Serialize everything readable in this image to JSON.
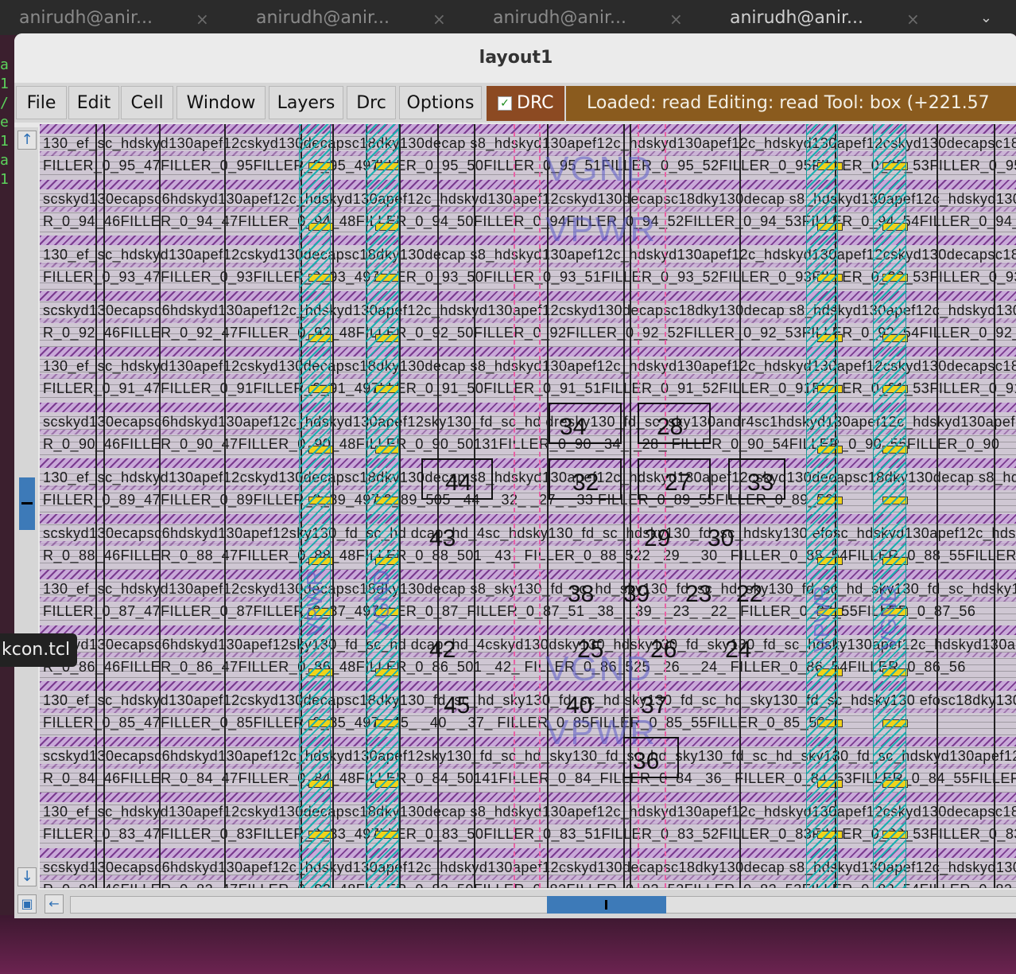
{
  "terminal_tabs": [
    {
      "label": "anirudh@anir...",
      "close": "×"
    },
    {
      "label": "anirudh@anir...",
      "close": "×"
    },
    {
      "label": "anirudh@anir...",
      "close": "×"
    },
    {
      "label": "anirudh@anir...",
      "close": "×"
    }
  ],
  "tab_menu_icon": "chevron-down-icon",
  "tooltip": "kcon.tcl",
  "window": {
    "title": "layout1",
    "menus": [
      "File",
      "Edit",
      "Cell",
      "Window",
      "Layers",
      "Drc",
      "Options"
    ],
    "drc_toggle": {
      "label": "DRC",
      "checked": true,
      "check": "✓"
    },
    "status": "Loaded: read Editing: read Tool: box    (+221.57"
  },
  "canvas": {
    "rows": [
      {
        "cells": "130_ef_sc_hdskyd130apef12cskyd130decapsc18dky130decap s8_hdskyd130apef12c_hdskyd130apef12c_hdskyd130apef12cskyd130decapsc18dky130decap s8_hdskyd130apef12",
        "fillers": "FILLER_0_95_47FILLER_0_95FILLER_0_95_497LLER_0_95_50FILLER_0_95_51FILLER_0_95_52FILLER_0_95FILLER_0_95_53FILLER_0_95_56"
      },
      {
        "cells": "scskyd130ecapsc6hdskyd130apef12c_hdskyd130apef12c_hdskyd130apef12cskyd130decapsc18dky130decap s8_hdskyd130apef12c_hdskyd130apef12c_hdskyd130apef12cs",
        "fillers": "R_0_94_46FILLER_0_94_47FILLER_0_94_48FILLER_0_94_50FILLER_0_94FILLER_0_94_52FILLER_0_94_53FILLER_0_94_54FILLER_0_94_55FILLER_0"
      },
      {
        "cells": "130_ef_sc_hdskyd130apef12cskyd130decapsc18dky130decap s8_hdskyd130apef12c_hdskyd130apef12c_hdskyd130apef12cskyd130decapsc18dky130decap s8_hdskyd130apef12",
        "fillers": "FILLER_0_93_47FILLER_0_93FILLER_0_93_497LLER_0_93_50FILLER_0_93_51FILLER_0_93_52FILLER_0_93FILLER_0_93_53FILLER_0_93_56"
      },
      {
        "cells": "scskyd130ecapsc6hdskyd130apef12c_hdskyd130apef12c_hdskyd130apef12cskyd130decapsc18dky130decap s8_hdskyd130apef12c_hdskyd130apef12c_hdskyd130apef12cs",
        "fillers": "R_0_92_46FILLER_0_92_47FILLER_0_92_48FILLER_0_92_50FILLER_0_92FILLER_0_92_52FILLER_0_92_53FILLER_0_92_54FILLER_0_92_55FILLER_0"
      },
      {
        "cells": "130_ef_sc_hdskyd130apef12cskyd130decapsc18dky130decap s8_hdskyd130apef12c_hdskyd130apef12c_hdskyd130apef12cskyd130decapsc18dky130decap s8_hdskyd130apef12",
        "fillers": "FILLER_0_91_47FILLER_0_91FILLER_0_91_497LLER_0_91_50FILLER_0_91_51FILLER_0_91_52FILLER_0_91FILLER_0_91_53FILLER_0_91_56"
      },
      {
        "cells": "scskyd130ecapsc6hdskyd130apef12c_hdskyd130apef12sky130_fd_sc_hd dresky130_fd_sc_sky130andr4sc1hdskyd130apef12c_hdskyd130apef12c_sky1",
        "fillers": "R_0_90_46FILLER_0_90_47FILLER_0_90_48FILLER_0_90_50131FILLER_0_90  _34_      _28_   FILLER_0_90_54FILLER_0_90_55FILLER_0_90"
      },
      {
        "cells": "130_ef_sc_hdskyd130apef12cskyd130decapsc18dky130decap s8_hdskyd130apef12c_hdskyd130apef12cskyd130decapsc18dky130decap s8_hdskyd130apef12",
        "fillers": "FILLER_0_89_47FILLER_0_89FILLER_0_89_497 0_89_505  _44_     _32_   _27_   _33 FILLER_0_89_55FILLER_0_89_56"
      },
      {
        "cells": "scskyd130ecapsc6hdskyd130apef12sky130_fd_sc_hd dcap_hd_4sc_hdsky130_fd_sc_hdsky130_fd_sc_hdsky130 efosc_hdskyd130apef12c_hdskyd130apef12c",
        "fillers": "R_0_88_46FILLER_0_88_47FILLER_0_88_48FILLER_0_88_501  _43_     FILLER_0_88_522  _29_  _30_ FILLER_0_88_54FILLER_0_88_55FILLER"
      },
      {
        "cells": "130_ef_sc_hdskyd130apef12cskyd130decapsc18dky130decap s8_sky130_fd_sc_hd_sky130_fd_sc_hd_sky130_fd_sc_hd_sky130_fd_sc_hdsky130decap s8_hdskyd130apef12",
        "fillers": "FILLER_0_87_47FILLER_0_87FILLER_0_87_497LLER_0_87_FILLER_0_87_51 _38_  _39_  _23_  _22_ FILLER_0_87_55FILLER_0_87_56"
      },
      {
        "cells": "scskyd130ecapsc6hdskyd130apef12sky130_fd_sc_hd dcap_hd_4cskyd130dsky130_hdsky130_fd_sky130_fd_sc_hdsky130apef12c_hdskyd130apef12c",
        "fillers": "R_0_86_46FILLER_0_86_47FILLER_0_86_48FILLER_0_86_501  _42_   FILLER_0_86_525  _26_   _24_ FILLER_0_86_54FILLER_0_86_56"
      },
      {
        "cells": "130_ef_sc_hdskyd130apef12cskyd130decapsc18dky130_fd_sc_hd_sky130_fd_sc_hd sky130_fd_sc_hd_sky130_fd_sc_hdsky130 efosc18dky130decap s8_hdskyd130apef12",
        "fillers": "FILLER_0_85_47FILLER_0_85FILLER_0_85_497   _45_       _40_    _37_   FILLER_0_85FILLER_0_85_55FILLER_0_85_56"
      },
      {
        "cells": "scskyd130ecapsc6hdskyd130apef12c_hdskyd130apef12sky130_fd_sc_hd_sky130_fd_sc_hd_sky130_fd_sc_hd_sky130_fd_sc_hdskyd130apef12c_hdskyd130apef12c_hdsky",
        "fillers": "R_0_84_46FILLER_0_84_47FILLER_0_84_48FILLER_0_84_50141FILLER_0_84_FILLER_0_84   _36_ FILLER_0_84_53FILLER_0_84_55FILLER_0_84_56"
      },
      {
        "cells": "130_ef_sc_hdskyd130apef12cskyd130decapsc18dky130decap s8_hdskyd130apef12c_hdskyd130apef12c_hdskyd130apef12cskyd130decapsc18dky130decap s8_hdskyd130apef12",
        "fillers": "FILLER_0_83_47FILLER_0_83FILLER_0_83_497LLER_0_83_50FILLER_0_83_51FILLER_0_83_52FILLER_0_83FILLER_0_83_53FILLER_0_83_56"
      },
      {
        "cells": "scskyd130ecapsc6hdskyd130apef12c_hdskyd130apef12c_hdskyd130apef12cskyd130decapsc18dky130decap s8_hdskyd130apef12c_hdskyd130apef12c_hdskyd130apef12cs",
        "fillers": "R_0_82_46FILLER_0_82_47FILLER_0_82_48FILLER_0_82_50FILLER_0_82FILLER_0_82_52FILLER_0_82_53FILLER_0_82_54FILLER_0_82_55FILLER_0"
      }
    ],
    "cell_numbers": [
      "34",
      "28",
      "44",
      "32",
      "27",
      "33",
      "43",
      "29",
      "30",
      "38",
      "39",
      "23",
      "22",
      "42",
      "25",
      "26",
      "24",
      "45",
      "40",
      "37",
      "36"
    ],
    "net_labels": [
      "VGND",
      "VPWR",
      "VGND",
      "VPWR"
    ],
    "rail_labels": [
      "VPWR",
      "VGND",
      "VPWR",
      "VGND"
    ]
  },
  "scroll_icons": {
    "up": "arrow-up-icon",
    "down": "arrow-down-icon",
    "left": "arrow-left-icon",
    "zoom": "zoom-box-icon"
  }
}
